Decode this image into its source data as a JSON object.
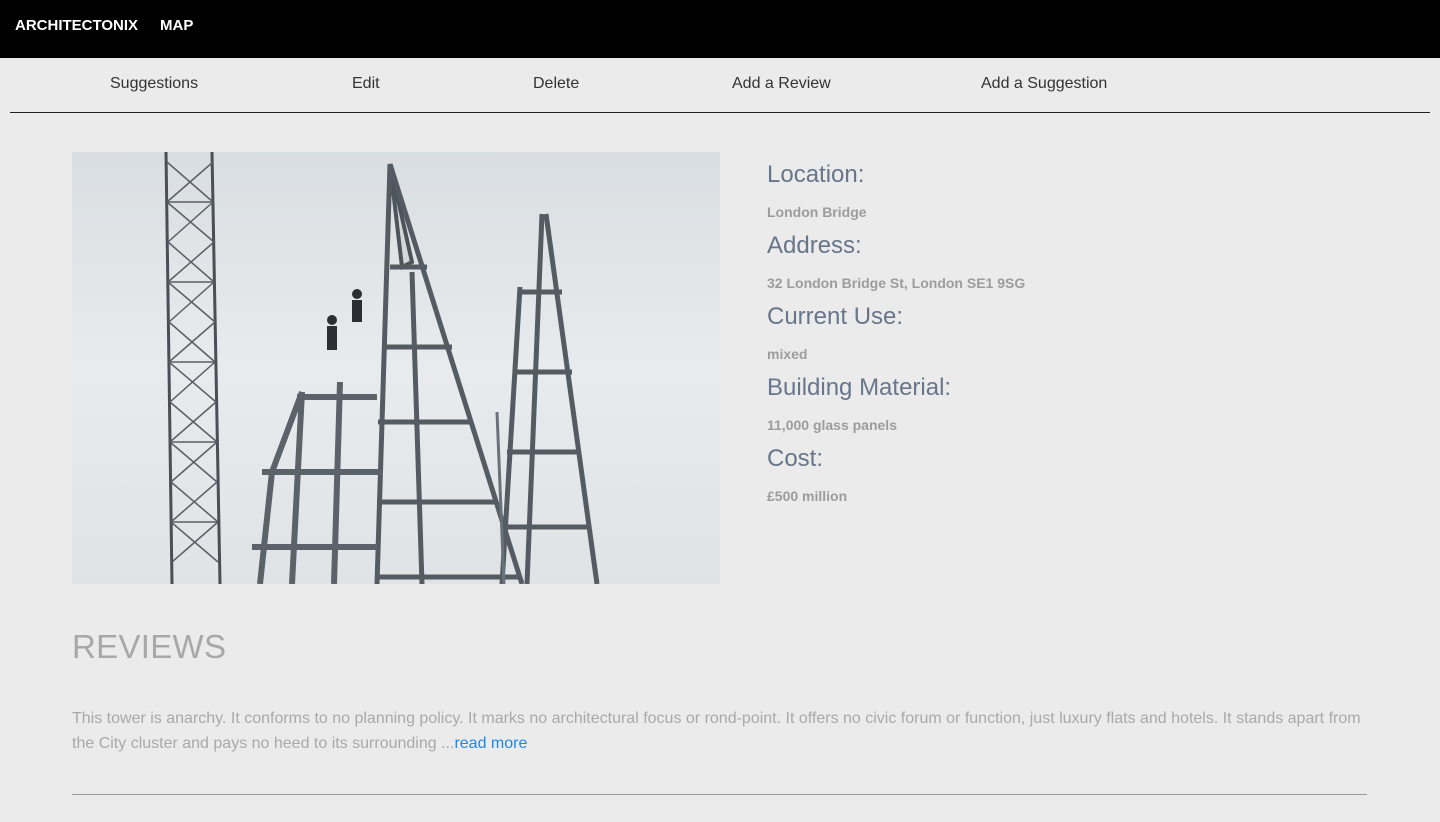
{
  "topbar": {
    "brand": "ARCHITECTONIX",
    "map_link": "MAP"
  },
  "subnav": {
    "items": [
      {
        "label": "Suggestions"
      },
      {
        "label": "Edit"
      },
      {
        "label": "Delete"
      },
      {
        "label": "Add a Review"
      },
      {
        "label": "Add a Suggestion"
      }
    ]
  },
  "details": {
    "location_label": "Location:",
    "location_value": "London Bridge",
    "address_label": "Address:",
    "address_value": "32 London Bridge St, London SE1 9SG",
    "use_label": "Current Use:",
    "use_value": "mixed",
    "material_label": "Building Material:",
    "material_value": "11,000 glass panels",
    "cost_label": "Cost:",
    "cost_value": "£500 million"
  },
  "reviews": {
    "title": "REVIEWS",
    "items": [
      {
        "text": "This tower is anarchy. It conforms to no planning policy. It marks no architectural focus or rond-point. It offers no civic forum or function, just luxury flats and hotels. It stands apart from the City cluster and pays no heed to its surrounding ...",
        "more_label": "read more"
      }
    ]
  },
  "colors": {
    "topbar_bg": "#000000",
    "page_bg": "#ebebeb",
    "label_color": "#67768b",
    "link_color": "#1e88e5"
  }
}
